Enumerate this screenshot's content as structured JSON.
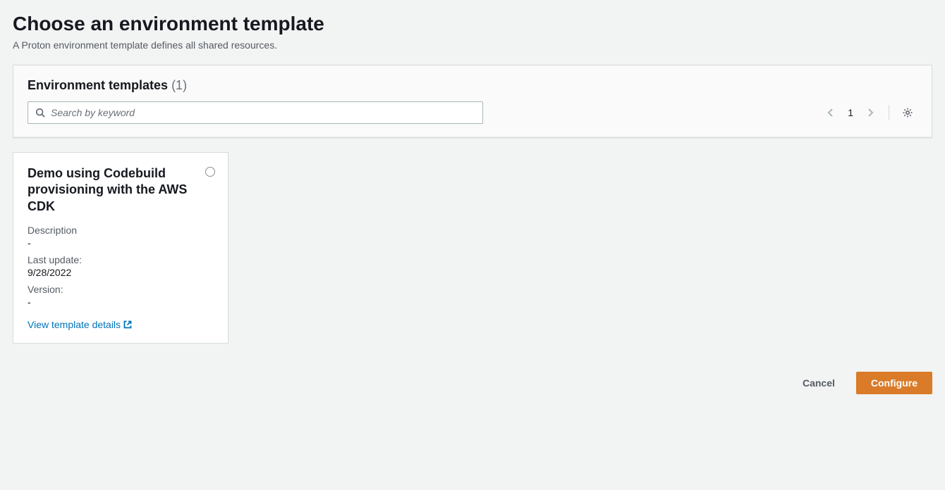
{
  "header": {
    "title": "Choose an environment template",
    "subtitle": "A Proton environment template defines all shared resources."
  },
  "panel": {
    "title": "Environment templates",
    "count": "(1)",
    "search_placeholder": "Search by keyword",
    "pagination": {
      "current": "1"
    }
  },
  "templates": [
    {
      "title": "Demo using Codebuild provisioning with the AWS CDK",
      "description_label": "Description",
      "description_value": "-",
      "last_update_label": "Last update:",
      "last_update_value": "9/28/2022",
      "version_label": "Version:",
      "version_value": "-",
      "view_link": "View template details"
    }
  ],
  "actions": {
    "cancel": "Cancel",
    "configure": "Configure"
  }
}
